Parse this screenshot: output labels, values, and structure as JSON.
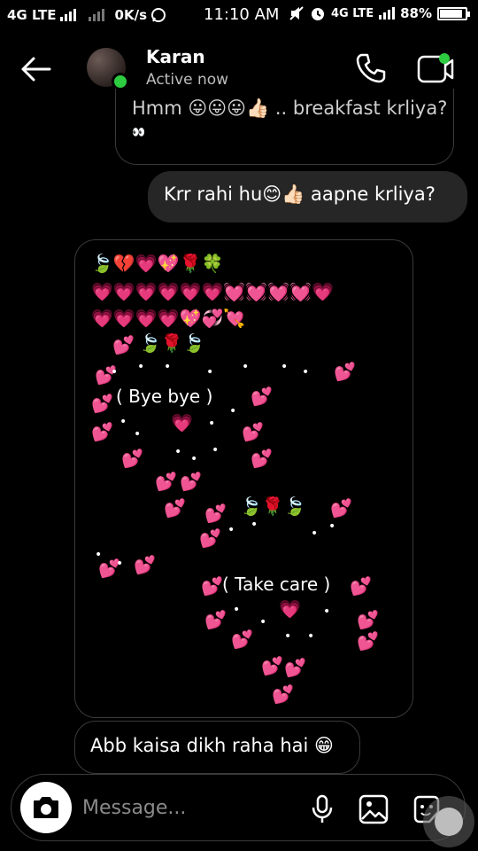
{
  "status_bar": {
    "network_left": "4G LTE",
    "speed": "0K/s",
    "time": "11:10 AM",
    "network_right": "4G LTE",
    "battery": "88%",
    "battery_level": 0.88
  },
  "header": {
    "contact_name": "Karan",
    "contact_status": "Active now",
    "icons": [
      "back-arrow-icon",
      "phone-icon",
      "video-call-icon"
    ]
  },
  "messages": {
    "m1_line1": "Hmm 😛😛😛👍🏻 .. breakfast krliya?",
    "m1_line2": "👀",
    "m2": "Krr rahi hu😊👍🏻 aapne krliya?",
    "m3_art": {
      "row1": "🍃💔💗💖🌹🍀",
      "row2": "💗💗💗💗💗💗💓💓💓💓💗",
      "row3": "💗💗💗💗💖💞💘",
      "row4": "🍃🌹🍃",
      "bye": "(   Bye bye   )",
      "row_b": "🍃🌹🍃",
      "take_care": "( Take care  )"
    },
    "m4": "Abb kaisa dikh raha hai 😁"
  },
  "composer": {
    "placeholder": "Message...",
    "icons": [
      "camera-icon",
      "microphone-icon",
      "gallery-icon",
      "sticker-icon"
    ]
  },
  "colors": {
    "background": "#000000",
    "outgoing_bubble": "#262626",
    "incoming_border": "#3a3a3a",
    "online": "#2ecc40",
    "heart": "#e8578c"
  }
}
